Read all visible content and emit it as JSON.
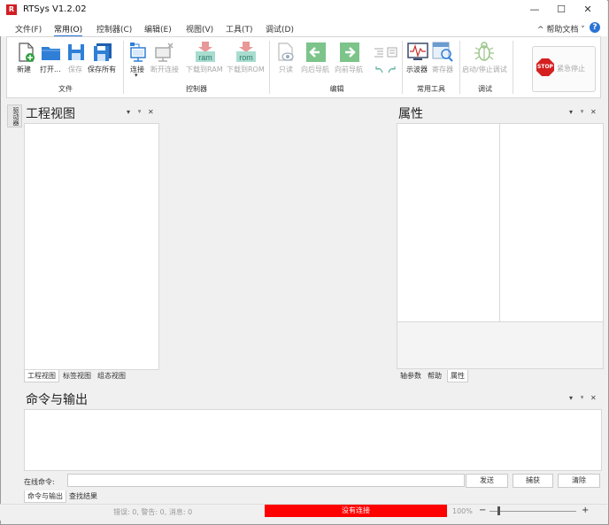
{
  "app": {
    "title": "RTSys V1.2.02",
    "logo_text": "R"
  },
  "window_controls": {
    "minimize": "—",
    "maximize": "☐",
    "close": "✕"
  },
  "menu": {
    "items": [
      "文件(F)",
      "常用(O)",
      "控制器(C)",
      "编辑(E)",
      "视图(V)",
      "工具(T)",
      "调试(D)"
    ],
    "active": "常用(O)",
    "help_link": "^ 帮助文档  ˅",
    "help_icon": "?"
  },
  "ribbon": {
    "file": {
      "label": "文件",
      "buttons": [
        "新建",
        "打开...",
        "保存",
        "保存所有"
      ]
    },
    "controller": {
      "label": "控制器",
      "buttons": [
        "连接",
        "断开连接",
        "下载到RAM",
        "下载到ROM"
      ],
      "ram_text": "ram",
      "rom_text": "rom"
    },
    "edit": {
      "label": "编辑",
      "buttons": [
        "只读",
        "向后导航",
        "向前导航"
      ]
    },
    "tools": {
      "label": "常用工具",
      "buttons": [
        "示波器",
        "寄存器"
      ]
    },
    "debug": {
      "label": "调试",
      "buttons": [
        "启动/停止调试"
      ]
    },
    "estop": {
      "label": "紧急停止",
      "icon_text": "STOP"
    }
  },
  "side_tab": "驱动器",
  "project_panel": {
    "title": "工程视图",
    "tabs": [
      "工程视图",
      "标签视图",
      "组态视图"
    ],
    "active_tab": "工程视图"
  },
  "props_panel": {
    "title": "属性",
    "tabs": [
      "轴参数",
      "帮助",
      "属性"
    ],
    "active_tab": "属性"
  },
  "panel_controls": {
    "dropdown": "▾",
    "pin": "ᵠ",
    "close": "✕"
  },
  "cmd_panel": {
    "title": "命令与输出",
    "online_label": "在线命令:",
    "input_value": "",
    "buttons": {
      "send": "发送",
      "capture": "捕获",
      "clear": "清除"
    },
    "tabs": [
      "命令与输出",
      "查找结果"
    ],
    "active_tab": "命令与输出"
  },
  "status": {
    "messages": "错误: 0, 警告: 0, 消息: 0",
    "connection": "没有连接",
    "connection_color": "#ff0000",
    "zoom": "100%",
    "zoom_minus": "−",
    "zoom_plus": "+"
  }
}
